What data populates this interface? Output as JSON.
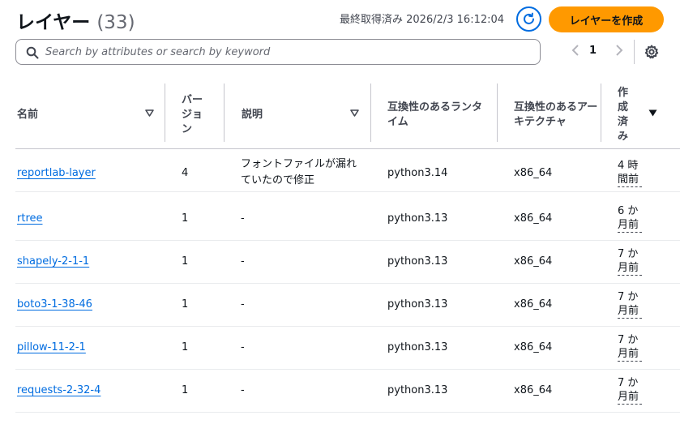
{
  "header": {
    "title": "レイヤー",
    "count": "(33)",
    "last_fetched": "最終取得済み 2026/2/3 16:12:04",
    "refresh_icon": "refresh-icon",
    "create_label": "レイヤーを作成"
  },
  "search": {
    "icon": "search-icon",
    "placeholder": "Search by attributes or search by keyword",
    "value": ""
  },
  "pagination": {
    "prev_icon": "chevron-left-icon",
    "current_page": "1",
    "next_icon": "chevron-right-icon",
    "settings_icon": "gear-icon"
  },
  "table": {
    "columns": {
      "name": "名前",
      "version": "バージョン",
      "description": "説明",
      "runtimes": "互換性のあるランタイム",
      "architectures": "互換性のあるアーキテクチャ",
      "created": "作成済み"
    },
    "sort_icons": {
      "name": "caret-down-outline-icon",
      "description": "caret-down-outline-icon",
      "created": "caret-down-filled-icon"
    },
    "rows": [
      {
        "name": "reportlab-layer",
        "version": "4",
        "description": "フォントファイルが漏れていたので修正",
        "runtime": "python3.14",
        "architecture": "x86_64",
        "created": "4 時間前"
      },
      {
        "name": "rtree",
        "version": "1",
        "description": "-",
        "runtime": "python3.13",
        "architecture": "x86_64",
        "created": "6 か月前"
      },
      {
        "name": "shapely-2-1-1",
        "version": "1",
        "description": "-",
        "runtime": "python3.13",
        "architecture": "x86_64",
        "created": "7 か月前"
      },
      {
        "name": "boto3-1-38-46",
        "version": "1",
        "description": "-",
        "runtime": "python3.13",
        "architecture": "x86_64",
        "created": "7 か月前"
      },
      {
        "name": "pillow-11-2-1",
        "version": "1",
        "description": "-",
        "runtime": "python3.13",
        "architecture": "x86_64",
        "created": "7 か月前"
      },
      {
        "name": "requests-2-32-4",
        "version": "1",
        "description": "-",
        "runtime": "python3.13",
        "architecture": "x86_64",
        "created": "7 か月前"
      }
    ]
  },
  "colors": {
    "accent_blue": "#006ce0",
    "primary_orange": "#ff9900",
    "text_dark": "#0f141a",
    "text_muted": "#656871"
  }
}
